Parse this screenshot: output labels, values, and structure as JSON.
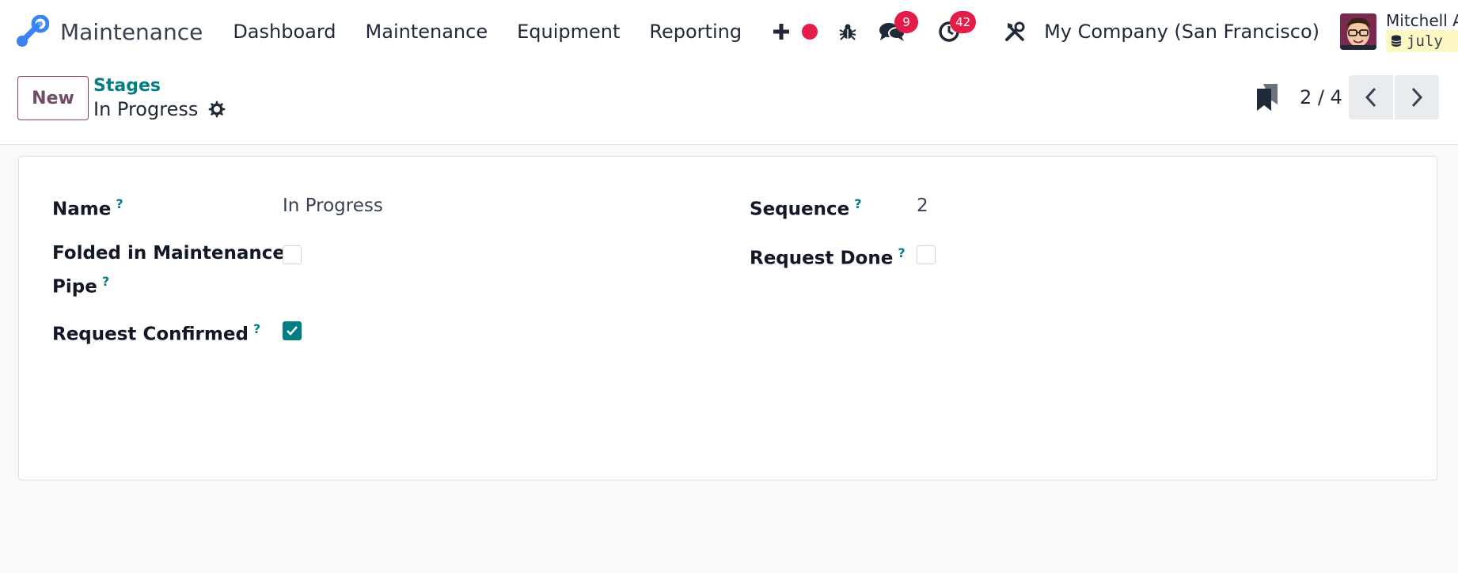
{
  "navbar": {
    "app_name": "Maintenance",
    "menu": [
      "Dashboard",
      "Maintenance",
      "Equipment",
      "Reporting"
    ],
    "messages_count": "9",
    "activities_count": "42",
    "company": "My Company (San Francisco)",
    "user_name": "Mitchell Admin",
    "database": "july",
    "icons": [
      "plus-icon",
      "record-dot-icon",
      "bug-icon",
      "chat-icon",
      "clock-icon",
      "tools-icon"
    ]
  },
  "control": {
    "new_label": "New",
    "breadcrumb": "Stages",
    "record_title": "In Progress",
    "pager": "2 / 4"
  },
  "form": {
    "name_label": "Name",
    "name_value": "In Progress",
    "folded_label_line1": "Folded in Maintenance",
    "folded_label_line2": "Pipe",
    "folded_value": false,
    "confirmed_label": "Request Confirmed",
    "confirmed_value": true,
    "sequence_label": "Sequence",
    "sequence_value": "2",
    "done_label": "Request Done",
    "done_value": false,
    "help_mark": "?"
  },
  "colors": {
    "brand_teal": "#017e84",
    "brand_purple": "#714b67",
    "badge_red": "#e11d48"
  }
}
